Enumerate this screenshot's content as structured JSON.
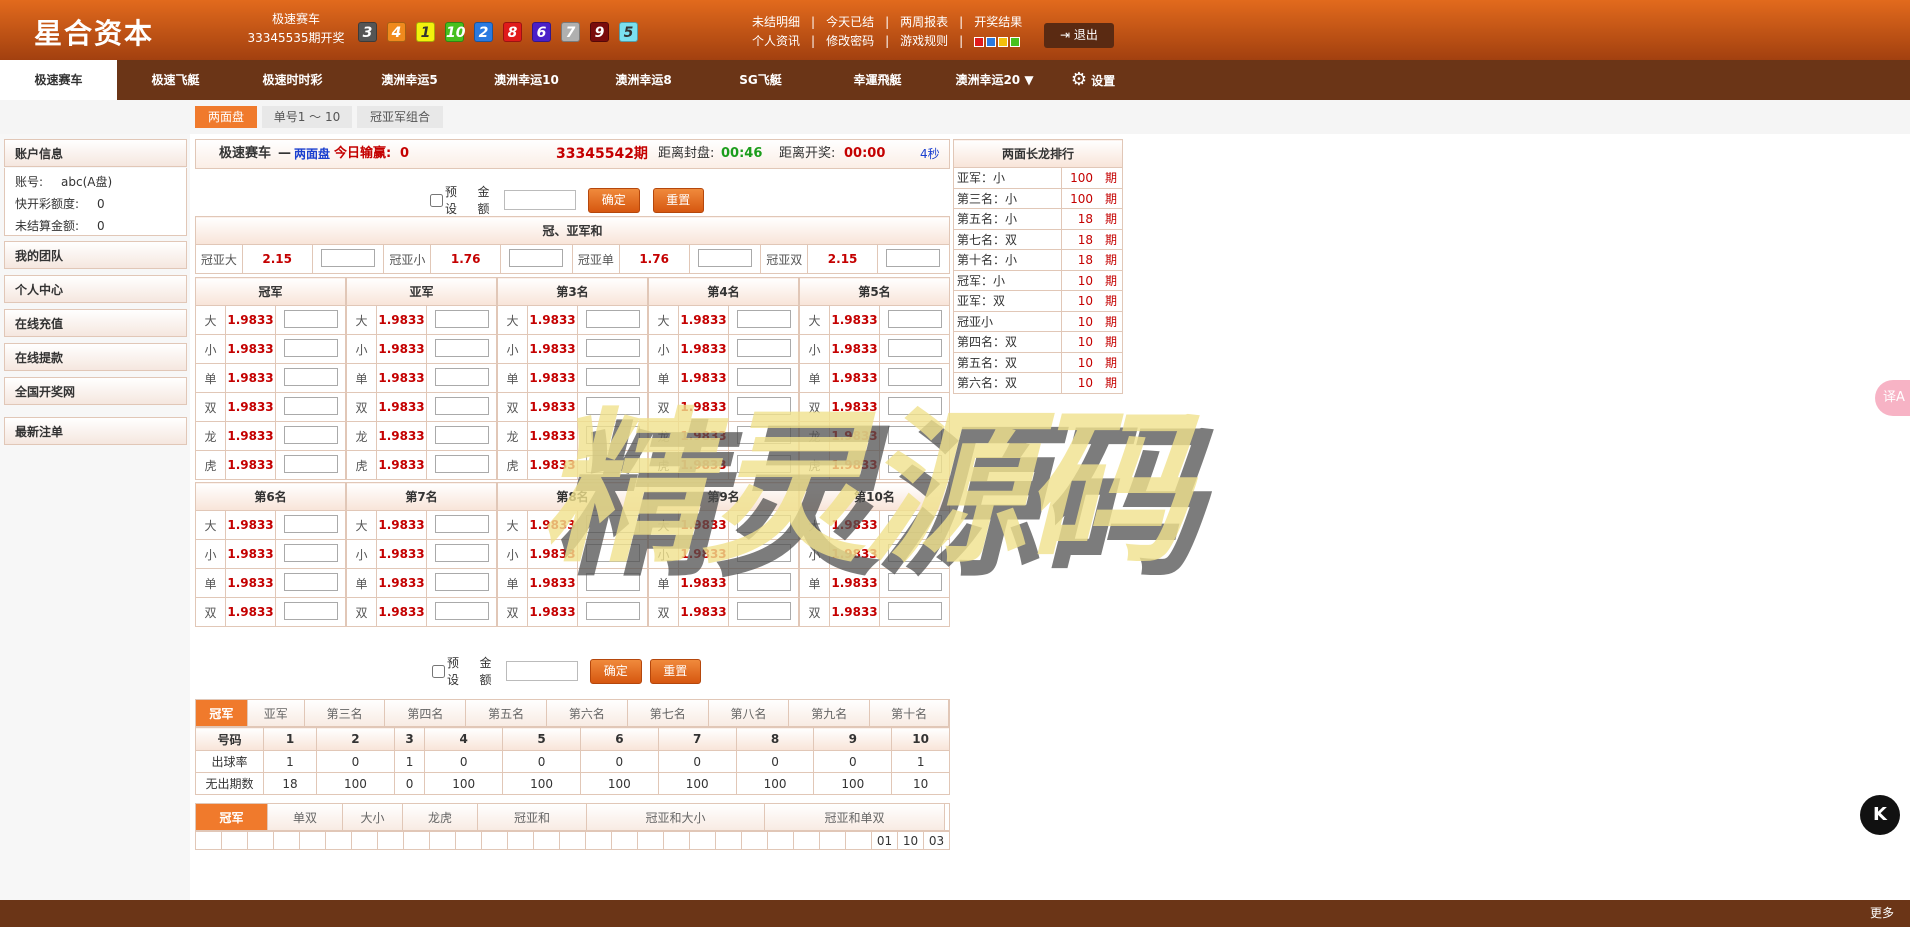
{
  "header": {
    "logo": "星合资本",
    "game_name": "极速赛车",
    "period_open": "33345535期开奖",
    "balls": [
      {
        "n": "3",
        "bg": "#555555",
        "fg": "#ffffff"
      },
      {
        "n": "4",
        "bg": "#f08a1d",
        "fg": "#ffffff"
      },
      {
        "n": "1",
        "bg": "#f2f20c",
        "fg": "#333333"
      },
      {
        "n": "10",
        "bg": "#46c01e",
        "fg": "#ffffff"
      },
      {
        "n": "2",
        "bg": "#2a7ae0",
        "fg": "#ffffff"
      },
      {
        "n": "8",
        "bg": "#e01b1b",
        "fg": "#ffffff"
      },
      {
        "n": "6",
        "bg": "#4a20c8",
        "fg": "#ffffff"
      },
      {
        "n": "7",
        "bg": "#b0b0b0",
        "fg": "#ffffff"
      },
      {
        "n": "9",
        "bg": "#7a0c0c",
        "fg": "#ffffff"
      },
      {
        "n": "5",
        "bg": "#7ae0f0",
        "fg": "#333333"
      }
    ],
    "links_row1": [
      "未结明细",
      "今天已结",
      "两周报表",
      "开奖结果"
    ],
    "links_row2": [
      "个人资讯",
      "修改密码",
      "游戏规则"
    ],
    "color_squares": [
      "#e01b1b",
      "#2a7ae0",
      "#f2c00c",
      "#46c01e"
    ],
    "logout": "退出"
  },
  "nav": {
    "tabs": [
      "极速赛车",
      "极速飞艇",
      "极速时时彩",
      "澳洲幸运5",
      "澳洲幸运10",
      "澳洲幸运8",
      "SG飞艇",
      "幸運飛艇",
      "澳洲幸运20 ▼"
    ],
    "settings": "设置"
  },
  "subnav": [
    "两面盘",
    "单号1 ～ 10",
    "冠亚军组合"
  ],
  "sidebar": {
    "account_title": "账户信息",
    "account_label": "账号:",
    "account_value": "abc(A盘)",
    "quota_label": "快开彩额度:",
    "quota_value": "0",
    "unsettled_label": "未结算金额:",
    "unsettled_value": "0",
    "menu": [
      "我的团队",
      "个人中心",
      "在线充值",
      "在线提款",
      "全国开奖网",
      "最新注单"
    ]
  },
  "main": {
    "game": "极速赛车",
    "dash": "—",
    "mode": "两面盘",
    "today": "今日输赢:",
    "today_val": "0",
    "period": "33345542期",
    "close_label": "距离封盘:",
    "close_time": "00:46",
    "open_label": "距离开奖:",
    "open_time": "00:00",
    "refresh": "4秒",
    "preset": "预设",
    "amount": "金额",
    "confirm": "确定",
    "reset": "重置",
    "gyh_title": "冠、亚军和",
    "gyh": [
      {
        "k": "冠亚大",
        "o": "2.15"
      },
      {
        "k": "冠亚小",
        "o": "1.76"
      },
      {
        "k": "冠亚单",
        "o": "1.76"
      },
      {
        "k": "冠亚双",
        "o": "2.15"
      }
    ],
    "groups1": [
      "冠军",
      "亚军",
      "第3名",
      "第4名",
      "第5名"
    ],
    "groups2": [
      "第6名",
      "第7名",
      "第8名",
      "第9名",
      "第10名"
    ],
    "keys1": [
      "大",
      "小",
      "单",
      "双",
      "龙",
      "虎"
    ],
    "keys2": [
      "大",
      "小",
      "单",
      "双"
    ],
    "odds": "1.9833"
  },
  "stats": {
    "tabs": [
      "冠军",
      "亚军",
      "第三名",
      "第四名",
      "第五名",
      "第六名",
      "第七名",
      "第八名",
      "第九名",
      "第十名"
    ],
    "head": [
      "号码",
      "1",
      "2",
      "3",
      "4",
      "5",
      "6",
      "7",
      "8",
      "9",
      "10"
    ],
    "rate_label": "出球率",
    "rate": [
      "1",
      "0",
      "1",
      "0",
      "0",
      "0",
      "0",
      "0",
      "0",
      "1"
    ],
    "miss_label": "无出期数",
    "miss": [
      "18",
      "100",
      "0",
      "100",
      "100",
      "100",
      "100",
      "100",
      "100",
      "10"
    ],
    "tabs2": [
      "冠军",
      "单双",
      "大小",
      "龙虎",
      "冠亚和",
      "冠亚和大小",
      "冠亚和单双"
    ],
    "last": [
      "01",
      "10",
      "03"
    ]
  },
  "rank": {
    "title": "两面长龙排行",
    "unit": "期",
    "rows": [
      {
        "n": "亚军：小",
        "v": "100"
      },
      {
        "n": "第三名：小",
        "v": "100"
      },
      {
        "n": "第五名：小",
        "v": "18"
      },
      {
        "n": "第七名：双",
        "v": "18"
      },
      {
        "n": "第十名：小",
        "v": "18"
      },
      {
        "n": "冠军：小",
        "v": "10"
      },
      {
        "n": "亚军：双",
        "v": "10"
      },
      {
        "n": "冠亚小",
        "v": "10"
      },
      {
        "n": "第四名：双",
        "v": "10"
      },
      {
        "n": "第五名：双",
        "v": "10"
      },
      {
        "n": "第六名：双",
        "v": "10"
      }
    ]
  },
  "watermark": "精灵源码",
  "footer": "更多",
  "float": {
    "k": "K",
    "trans": "译A"
  }
}
